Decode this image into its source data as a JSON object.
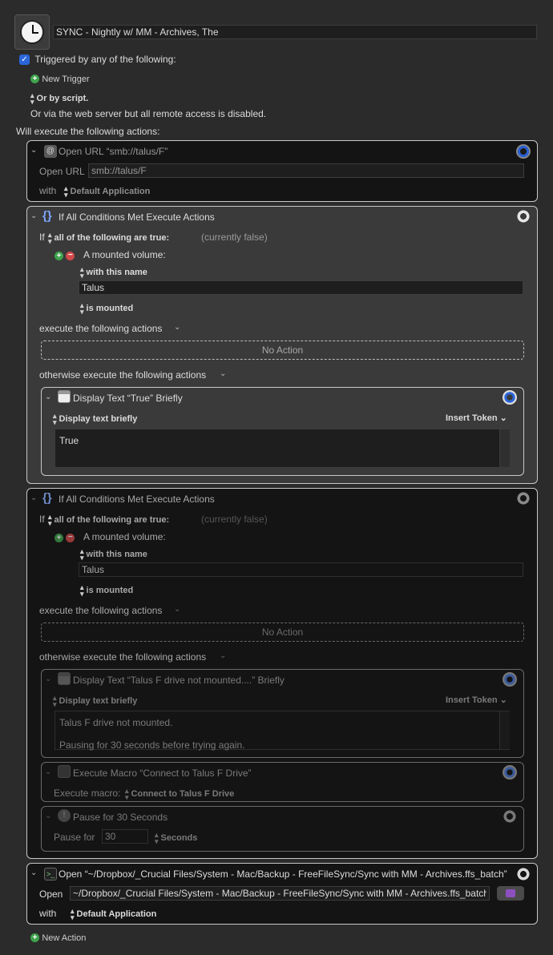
{
  "macro": {
    "name": "SYNC - Nightly w/ MM - Archives, The",
    "trigger_label": "Triggered by any of the following:",
    "new_trigger": "New Trigger",
    "or_by_script": "Or by script.",
    "web_server_note": "Or via the web server but all remote access is disabled.",
    "will_execute": "Will execute the following actions:",
    "new_action": "New Action"
  },
  "action1": {
    "title": "Open URL “smb://talus/F”",
    "url_label": "Open URL",
    "url_value": "smb://talus/F",
    "with_label": "with",
    "app": "Default Application"
  },
  "action2": {
    "title": "If All Conditions Met Execute Actions",
    "if_label": "If",
    "all_of": "all of the following are true:",
    "status": "(currently false)",
    "condition": "A mounted volume:",
    "with_name": "with this name",
    "volume": "Talus",
    "is_mounted": "is mounted",
    "execute": "execute the following actions",
    "no_action": "No Action",
    "otherwise": "otherwise execute the following actions",
    "sub": {
      "title": "Display Text “True” Briefly",
      "mode": "Display text briefly",
      "insert_token": "Insert Token",
      "text": "True"
    }
  },
  "action3": {
    "title": "If All Conditions Met Execute Actions",
    "if_label": "If",
    "all_of": "all of the following are true:",
    "status": "(currently false)",
    "condition": "A mounted volume:",
    "with_name": "with this name",
    "volume": "Talus",
    "is_mounted": "is mounted",
    "execute": "execute the following actions",
    "no_action": "No Action",
    "otherwise": "otherwise execute the following actions",
    "sub1": {
      "title": "Display Text “Talus F drive not mounted....” Briefly",
      "mode": "Display text briefly",
      "insert_token": "Insert Token",
      "line1": "Talus F drive not mounted.",
      "line2": "Pausing for 30 seconds before trying again."
    },
    "sub2": {
      "title": "Execute Macro “Connect to Talus F Drive”",
      "label": "Execute macro:",
      "macro": "Connect to Talus F Drive"
    },
    "sub3": {
      "title": "Pause for 30 Seconds",
      "label": "Pause for",
      "value": "30",
      "unit": "Seconds"
    }
  },
  "action4": {
    "title": "Open “~/Dropbox/_Crucial Files/System - Mac/Backup - FreeFileSync/Sync with MM - Archives.ffs_batch”",
    "open_label": "Open",
    "path": "~/Dropbox/_Crucial Files/System - Mac/Backup - FreeFileSync/Sync with MM - Archives.ffs_batch",
    "with_label": "with",
    "app": "Default Application"
  },
  "colors": {
    "background": "#2b2b2b",
    "accent_blue": "#2b66d9",
    "add_green": "#3fa34d",
    "remove_red": "#d04a4a"
  }
}
